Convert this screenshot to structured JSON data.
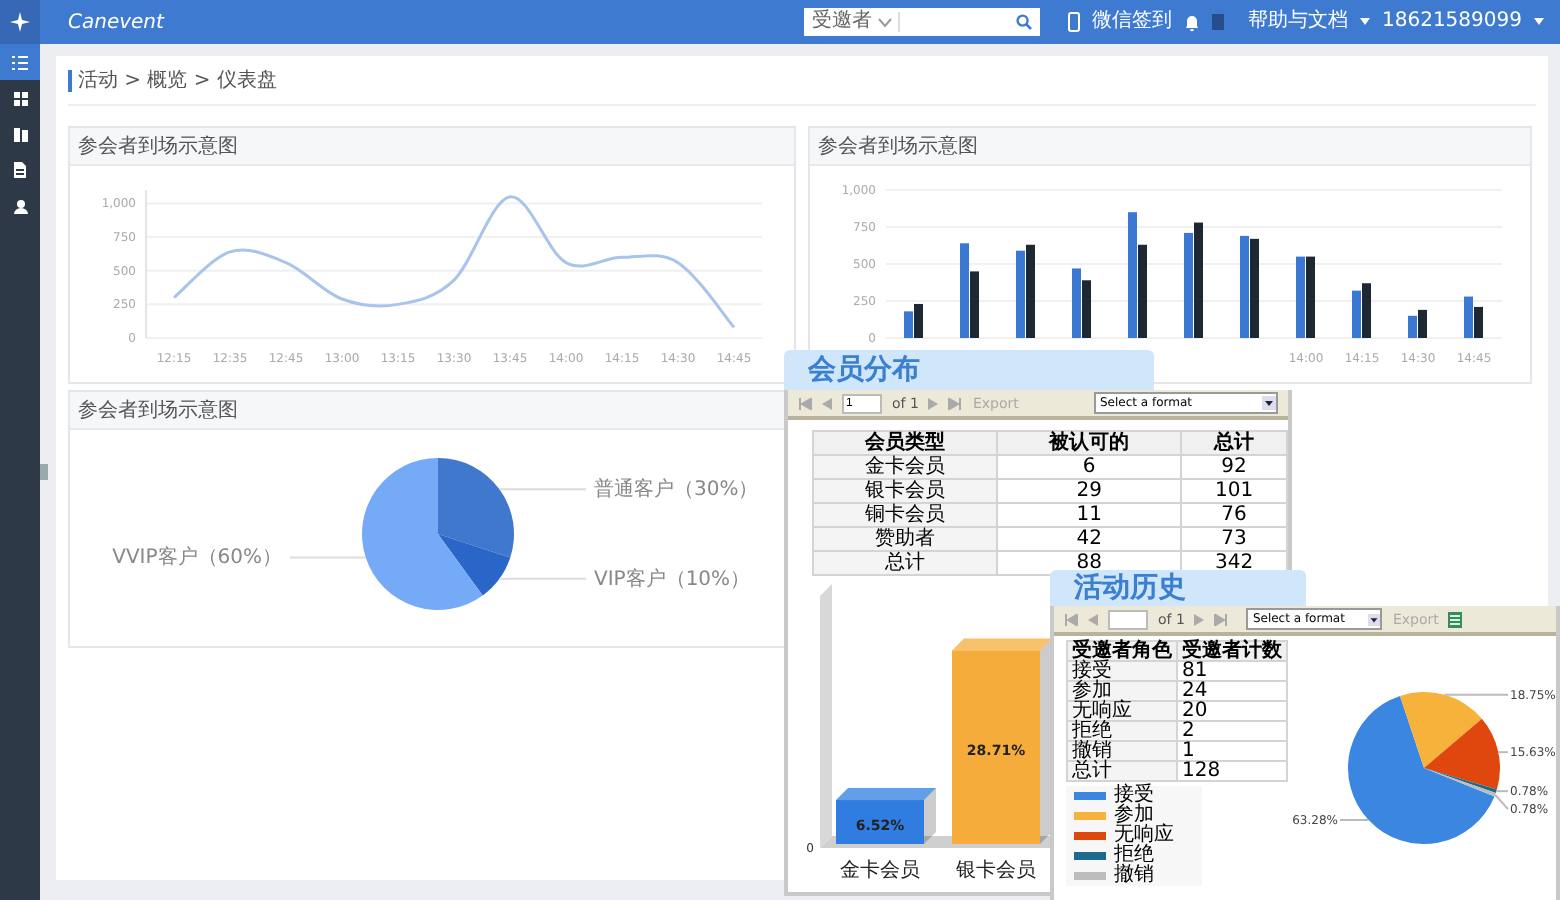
{
  "topbar": {
    "logo": "Canevent",
    "search": {
      "scope": "受邀者"
    },
    "checkin": "微信签到",
    "help": "帮助与文档",
    "user": "18621589099"
  },
  "sidebar": {
    "items": [
      {
        "kind": "list",
        "selected": true
      },
      {
        "kind": "grid",
        "selected": false
      },
      {
        "kind": "book",
        "selected": false
      },
      {
        "kind": "document",
        "selected": false
      },
      {
        "kind": "person",
        "selected": false
      }
    ]
  },
  "breadcrumb": "活动 > 概览 > 仪表盘",
  "line_panel": {
    "title": "参会者到场示意图",
    "chart_data": {
      "type": "line",
      "categories": [
        "12:15",
        "12:35",
        "12:45",
        "13:00",
        "13:15",
        "13:30",
        "13:45",
        "14:00",
        "14:15",
        "14:30",
        "14:45"
      ],
      "values": [
        300,
        640,
        560,
        290,
        250,
        430,
        1050,
        560,
        600,
        560,
        80
      ],
      "ylim": [
        0,
        1100
      ],
      "grid": true,
      "yticks": [
        0,
        250,
        500,
        750,
        {
          "value": 1000,
          "label": "1,000"
        }
      ]
    }
  },
  "bar_panel": {
    "title": "参会者到场示意图",
    "chart_data": {
      "type": "bar",
      "categories": [
        null,
        null,
        null,
        null,
        null,
        null,
        null,
        "14:00",
        "14:15",
        "14:30",
        "14:45"
      ],
      "series": [
        {
          "color": "#3b78d4",
          "values": [
            180,
            640,
            590,
            470,
            850,
            710,
            690,
            550,
            320,
            150,
            280
          ]
        },
        {
          "color": "#1e2833",
          "values": [
            230,
            450,
            630,
            390,
            630,
            780,
            670,
            550,
            370,
            190,
            210
          ]
        }
      ],
      "ylim": [
        0,
        1000
      ],
      "grid": true,
      "yticks": [
        0,
        250,
        500,
        750,
        {
          "value": 1000,
          "label": "1,000"
        }
      ]
    }
  },
  "pie_panel": {
    "title": "参会者到场示意图",
    "chart_data": {
      "type": "pie",
      "categories": [
        "普通客户（30%）",
        "VIP客户（10%）",
        "VVIP客户（60%）"
      ],
      "values": [
        30,
        10,
        60
      ],
      "colors": [
        "#3f78cc",
        "#2a66c8",
        "#74aaf6"
      ]
    }
  },
  "member_report": {
    "title": "会员分布",
    "toolbar": {
      "page": "1",
      "of": "of 1",
      "export": "Export",
      "format": "Select a format"
    },
    "table": {
      "columns": [
        "会员类型",
        "被认可的",
        "总计"
      ],
      "rows": [
        [
          "金卡会员",
          "6",
          "92"
        ],
        [
          "银卡会员",
          "29",
          "101"
        ],
        [
          "铜卡会员",
          "11",
          "76"
        ],
        [
          "赞助者",
          "42",
          "73"
        ],
        [
          "总计",
          "88",
          "342"
        ]
      ]
    },
    "chart_data": {
      "type": "bar",
      "categories": [
        "金卡会员",
        "银卡会员"
      ],
      "values": [
        6.52,
        28.71
      ],
      "value_labels": [
        "6.52%",
        "28.71%"
      ],
      "colors": [
        "#2f7de0",
        "#f5ac3a"
      ]
    },
    "origin_label": "0"
  },
  "history_report": {
    "title": "活动历史",
    "toolbar": {
      "of": "of 1",
      "export": "Export",
      "format": "Select a format"
    },
    "table": {
      "columns": [
        "受邀者角色",
        "受邀者计数"
      ],
      "rows": [
        [
          "接受",
          "81"
        ],
        [
          "参加",
          "24"
        ],
        [
          "无响应",
          "20"
        ],
        [
          "拒绝",
          "2"
        ],
        [
          "撤销",
          "1"
        ],
        [
          "总计",
          "128"
        ]
      ]
    },
    "chart_data": {
      "type": "pie",
      "categories": [
        "接受",
        "参加",
        "无响应",
        "拒绝",
        "撤销"
      ],
      "values": [
        63.28,
        18.75,
        15.63,
        0.78,
        0.78
      ],
      "value_labels": [
        "63.28%",
        "18.75%",
        "15.63%",
        "0.78%",
        "0.78%"
      ],
      "colors": [
        "#3a86e0",
        "#f7b23b",
        "#e0470e",
        "#1e6a8d",
        "#bdbdbd"
      ]
    }
  }
}
